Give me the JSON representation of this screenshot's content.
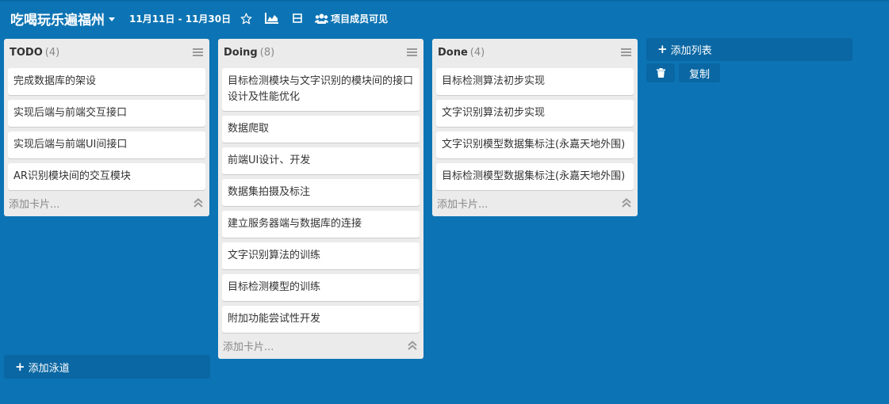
{
  "board": {
    "title": "吃喝玩乐遍福州",
    "date_range": "11月11日 - 11月30日",
    "members_label": "项目成员可见"
  },
  "icons": {
    "star": "star-icon",
    "chart": "area-chart-icon",
    "calendar": "calendar-icon",
    "members": "users-icon",
    "menu": "hamburger-menu-icon",
    "collapse": "double-chevron-up-icon",
    "trash": "trash-icon",
    "plus": "plus-icon"
  },
  "lists": [
    {
      "name": "TODO",
      "count": "(4)",
      "cards": [
        "完成数据库的架设",
        "实现后端与前端交互接口",
        "实现后端与前端UI间接口",
        "AR识别模块间的交互模块"
      ],
      "add_card": "添加卡片..."
    },
    {
      "name": "Doing",
      "count": "(8)",
      "cards": [
        "目标检测模块与文字识别的模块间的接口设计及性能优化",
        "数据爬取",
        "前端UI设计、开发",
        "数据集拍摄及标注",
        "建立服务器端与数据库的连接",
        "文字识别算法的训练",
        "目标检测模型的训练",
        "附加功能尝试性开发"
      ],
      "add_card": "添加卡片..."
    },
    {
      "name": "Done",
      "count": "(4)",
      "cards": [
        "目标检测算法初步实现",
        "文字识别算法初步实现",
        "文字识别模型数据集标注(永嘉天地外围)",
        "目标检测模型数据集标注(永嘉天地外围)"
      ],
      "add_card": "添加卡片..."
    }
  ],
  "actions": {
    "add_list": "添加列表",
    "copy": "复制",
    "add_lane": "添加泳道"
  },
  "colors": {
    "background": "#0c74b4",
    "control": "#0a67a3",
    "list": "#ebebeb",
    "card": "#ffffff"
  }
}
